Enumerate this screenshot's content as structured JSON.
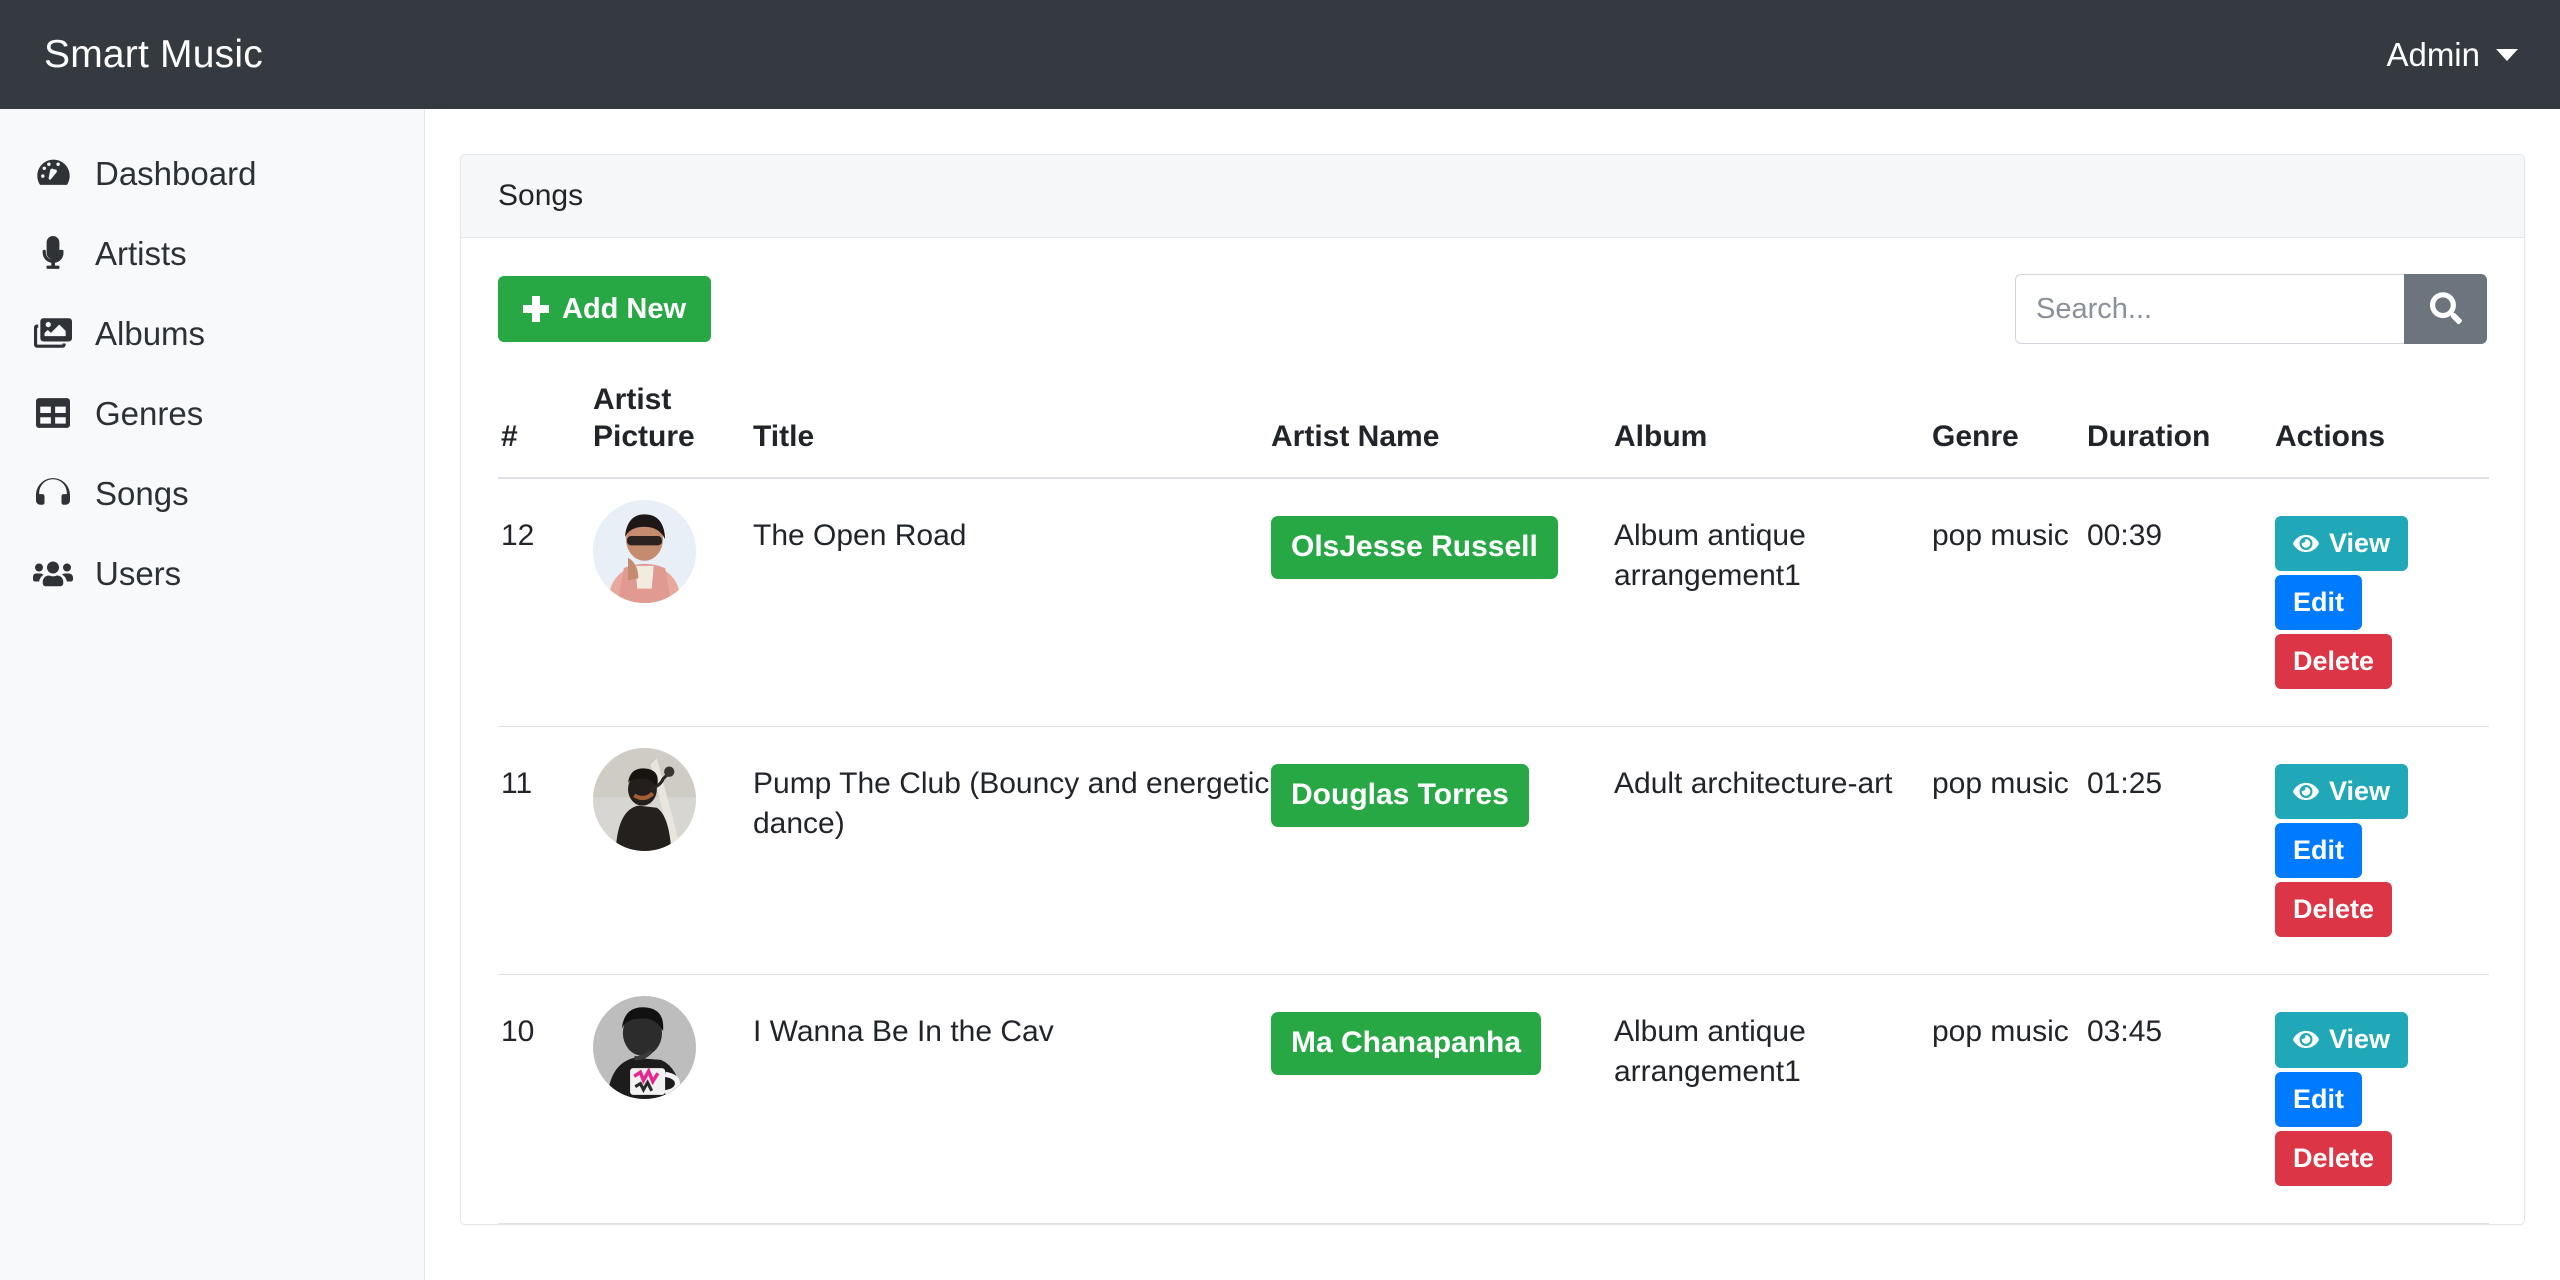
{
  "navbar": {
    "brand": "Smart Music",
    "user_menu": "Admin"
  },
  "sidebar": {
    "items": [
      {
        "label": "Dashboard",
        "icon": "dashboard-gauge-icon"
      },
      {
        "label": "Artists",
        "icon": "microphone-icon"
      },
      {
        "label": "Albums",
        "icon": "images-icon"
      },
      {
        "label": "Genres",
        "icon": "table-grid-icon"
      },
      {
        "label": "Songs",
        "icon": "headphones-icon"
      },
      {
        "label": "Users",
        "icon": "users-group-icon"
      }
    ]
  },
  "card": {
    "title": "Songs"
  },
  "toolbar": {
    "add_label": "Add New",
    "search_placeholder": "Search...",
    "search_value": ""
  },
  "table": {
    "headers": {
      "index": "#",
      "picture_line1": "Artist",
      "picture_line2": "Picture",
      "title": "Title",
      "artist_name": "Artist Name",
      "album": "Album",
      "genre": "Genre",
      "duration": "Duration",
      "actions": "Actions"
    },
    "action_labels": {
      "view": "View",
      "edit": "Edit",
      "delete": "Delete"
    },
    "rows": [
      {
        "index": "12",
        "title": "The Open Road",
        "artist_name": "OlsJesse Russell",
        "album": "Album antique arrangement1",
        "genre": "pop music",
        "duration": "00:39",
        "avatar_style": "pink-jacket-sunglasses"
      },
      {
        "index": "11",
        "title": "Pump The Club (Bouncy and energetic dance)",
        "artist_name": "Douglas Torres",
        "album": "Adult architecture-art",
        "genre": "pop music",
        "duration": "01:25",
        "avatar_style": "singer-silhouette"
      },
      {
        "index": "10",
        "title": "I Wanna Be In the Cav",
        "artist_name": "Ma Chanapanha",
        "album": "Album antique arrangement1",
        "genre": "pop music",
        "duration": "03:45",
        "avatar_style": "bw-portrait-mug"
      }
    ]
  },
  "colors": {
    "navbar_bg": "#343a40",
    "sidebar_bg": "#f8f9fa",
    "success": "#28a745",
    "info": "#20a8b8",
    "primary": "#007bff",
    "danger": "#dc3545",
    "secondary": "#6c757d"
  }
}
